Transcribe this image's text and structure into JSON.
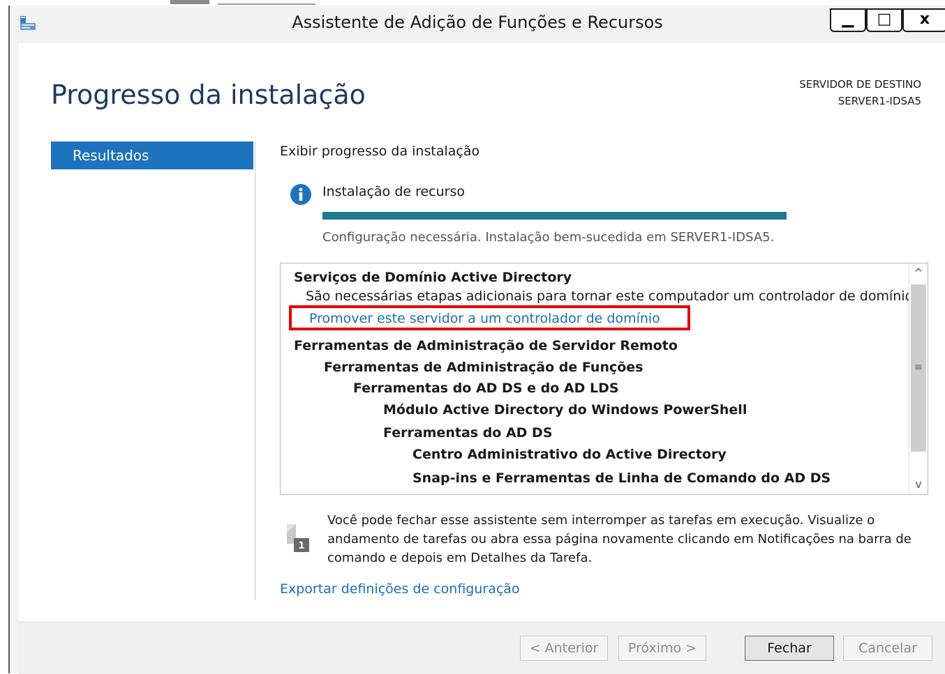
{
  "window": {
    "title": "Assistente de Adição de Funções e Recursos",
    "controls": {
      "minimize": "▁",
      "maximize": "□",
      "close": "x"
    }
  },
  "header": {
    "page_title": "Progresso da instalação",
    "destination_label": "SERVIDOR DE DESTINO",
    "destination_server": "SERVER1-IDSA5"
  },
  "sidebar": {
    "items": [
      {
        "label": "Resultados",
        "active": true
      }
    ]
  },
  "main": {
    "section_heading": "Exibir progresso da instalação",
    "feature_installation": "Instalação de recurso",
    "progress_fraction": 1.0,
    "status_text": "Configuração necessária. Instalação bem-sucedida em SERVER1-IDSA5.",
    "results": [
      {
        "text": "Serviços de Domínio Active Directory",
        "style": "bold"
      },
      {
        "text": "São necessárias etapas adicionais para tornar este computador um controlador de domínio.",
        "style": "normal"
      },
      {
        "text": "Promover este servidor a um controlador de domínio",
        "style": "link"
      },
      {
        "text": "Ferramentas de Administração de Servidor Remoto",
        "style": "bold"
      },
      {
        "text": "Ferramentas de Administração de Funções",
        "style": "bold"
      },
      {
        "text": "Ferramentas do AD DS e do AD LDS",
        "style": "bold"
      },
      {
        "text": "Módulo Active Directory do Windows PowerShell",
        "style": "bold"
      },
      {
        "text": "Ferramentas do AD DS",
        "style": "bold"
      },
      {
        "text": "Centro Administrativo do Active Directory",
        "style": "bold"
      },
      {
        "text": "Snap-ins e Ferramentas de Linha de Comando do AD DS",
        "style": "bold"
      }
    ],
    "note_badge": "1",
    "note_text": "Você pode fechar esse assistente sem interromper as tarefas em execução. Visualize o andamento de tarefas ou abra essa página novamente clicando em Notificações na barra de comando e depois em Detalhes da Tarefa.",
    "export_link": "Exportar definições de configuração"
  },
  "footer": {
    "previous": "< Anterior",
    "next": "Próximo >",
    "close": "Fechar",
    "cancel": "Cancelar"
  },
  "colors": {
    "accent": "#1e73be",
    "progress": "#1f7a8c",
    "link": "#1a6fb0",
    "highlight": "#e60000"
  }
}
